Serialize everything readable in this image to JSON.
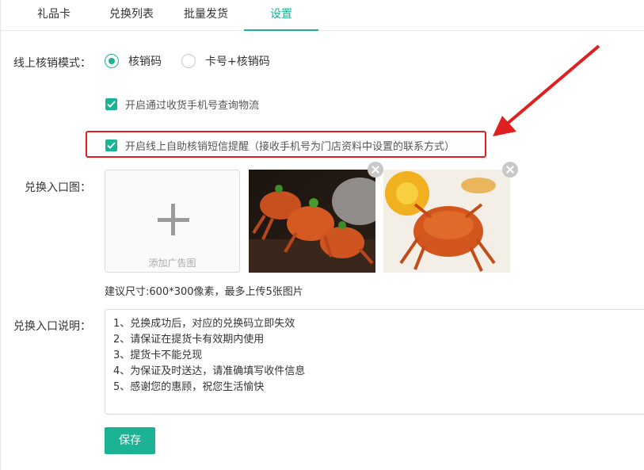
{
  "tabs": [
    {
      "label": "礼品卡"
    },
    {
      "label": "兑换列表"
    },
    {
      "label": "批量发货"
    },
    {
      "label": "设置",
      "active": true
    }
  ],
  "verify_mode": {
    "label": "线上核销模式：",
    "options": [
      {
        "label": "核销码",
        "checked": true
      },
      {
        "label": "卡号+核销码",
        "checked": false
      }
    ]
  },
  "checkboxes": {
    "logistics": {
      "label": "开启通过收货手机号查询物流",
      "checked": true
    },
    "sms": {
      "label": "开启线上自助核销短信提醒（接收手机号为门店资料中设置的联系方式）",
      "checked": true
    }
  },
  "entry_image": {
    "label": "兑换入口图：",
    "add_label": "添加广告图",
    "hint": "建议尺寸:600*300像素，最多上传5张图片"
  },
  "entry_desc": {
    "label": "兑换入口说明：",
    "lines": [
      "1、兑换成功后，对应的兑换码立即失效",
      "2、请保证在提货卡有效期内使用",
      "3、提货卡不能兑现",
      "4、为保证及时送达，请准确填写收件信息",
      "5、感谢您的惠顾，祝您生活愉快"
    ]
  },
  "save_label": "保存",
  "colors": {
    "accent": "#1bb394",
    "highlight": "#e02020"
  }
}
